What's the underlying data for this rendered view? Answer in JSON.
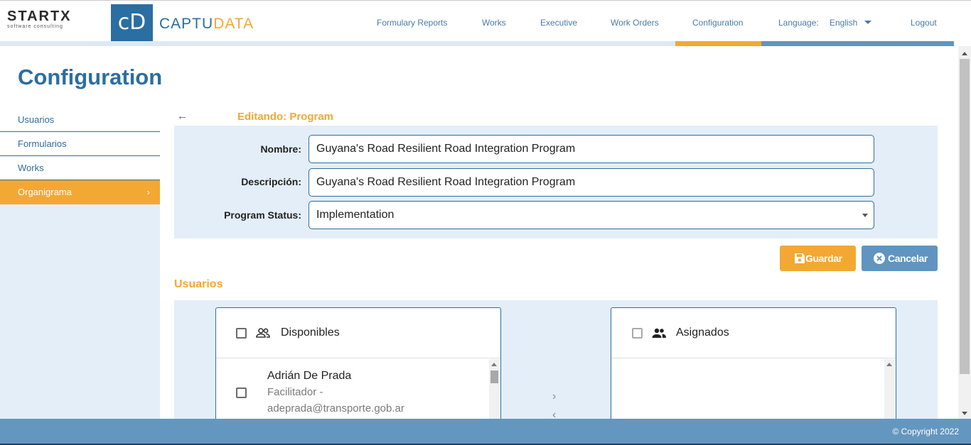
{
  "brand": {
    "startx_word_a": "STARTX",
    "startx_tagline": "software consulting",
    "cd_mark": "cD",
    "captu": "CAPTU",
    "data": "DATA"
  },
  "nav": {
    "items": [
      {
        "label": "Formulary Reports"
      },
      {
        "label": "Works"
      },
      {
        "label": "Executive"
      },
      {
        "label": "Work Orders"
      },
      {
        "label": "Configuration"
      }
    ],
    "language_label": "Language:",
    "language_value": "English",
    "logout": "Logout"
  },
  "page": {
    "title": "Configuration"
  },
  "sidebar": {
    "items": [
      {
        "label": "Usuarios"
      },
      {
        "label": "Formularios"
      },
      {
        "label": "Works"
      },
      {
        "label": "Organigrama"
      }
    ],
    "active_chevron": "›"
  },
  "editor": {
    "back_icon": "←",
    "title": "Editando: Program",
    "fields": {
      "nombre_label": "Nombre:",
      "nombre_value": "Guyana's Road Resilient Road Integration Program",
      "descripcion_label": "Descripción:",
      "descripcion_value": "Guyana's Road Resilient Road Integration Program",
      "status_label": "Program Status:",
      "status_value": "Implementation"
    },
    "save_label": "Guardar",
    "cancel_label": "Cancelar"
  },
  "users": {
    "section_title": "Usuarios",
    "available": {
      "title": "Disponibles",
      "items": [
        {
          "name": "Adrián De Prada",
          "role": "Facilitador -",
          "email": "adeprada@transporte.gob.ar"
        }
      ]
    },
    "assigned": {
      "title": "Asignados"
    },
    "move_right": "›",
    "move_left": "‹"
  },
  "footer": {
    "copyright": "© Copyright 2022"
  },
  "colors": {
    "primary": "#2b6ea1",
    "accent": "#f3a833",
    "panel": "#e4eef8",
    "footer": "#6497c0"
  }
}
